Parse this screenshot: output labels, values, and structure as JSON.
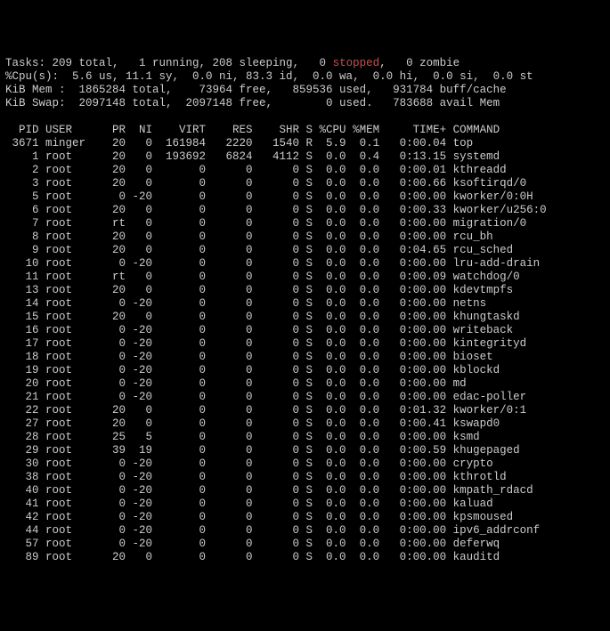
{
  "summary": {
    "tasks_line_pre": "Tasks: 209 total,   1 running, 208 sleeping,   0 ",
    "tasks_stopped_word": "stopped",
    "tasks_line_post": ",   0 zombie",
    "cpu_line": "%Cpu(s):  5.6 us, 11.1 sy,  0.0 ni, 83.3 id,  0.0 wa,  0.0 hi,  0.0 si,  0.0 st",
    "mem_line": "KiB Mem :  1865284 total,    73964 free,   859536 used,   931784 buff/cache",
    "swap_line": "KiB Swap:  2097148 total,  2097148 free,        0 used.   783688 avail Mem"
  },
  "columns": "  PID USER      PR  NI    VIRT    RES    SHR S %CPU %MEM     TIME+ COMMAND          ",
  "processes": [
    {
      "pid": 3671,
      "user": "minger",
      "pr": "20",
      "ni": "0",
      "virt": "161984",
      "res": "2220",
      "shr": "1540",
      "s": "R",
      "cpu": "5.9",
      "mem": "0.1",
      "time": "0:00.04",
      "cmd": "top"
    },
    {
      "pid": 1,
      "user": "root",
      "pr": "20",
      "ni": "0",
      "virt": "193692",
      "res": "6824",
      "shr": "4112",
      "s": "S",
      "cpu": "0.0",
      "mem": "0.4",
      "time": "0:13.15",
      "cmd": "systemd"
    },
    {
      "pid": 2,
      "user": "root",
      "pr": "20",
      "ni": "0",
      "virt": "0",
      "res": "0",
      "shr": "0",
      "s": "S",
      "cpu": "0.0",
      "mem": "0.0",
      "time": "0:00.01",
      "cmd": "kthreadd"
    },
    {
      "pid": 3,
      "user": "root",
      "pr": "20",
      "ni": "0",
      "virt": "0",
      "res": "0",
      "shr": "0",
      "s": "S",
      "cpu": "0.0",
      "mem": "0.0",
      "time": "0:00.66",
      "cmd": "ksoftirqd/0"
    },
    {
      "pid": 5,
      "user": "root",
      "pr": "0",
      "ni": "-20",
      "virt": "0",
      "res": "0",
      "shr": "0",
      "s": "S",
      "cpu": "0.0",
      "mem": "0.0",
      "time": "0:00.00",
      "cmd": "kworker/0:0H"
    },
    {
      "pid": 6,
      "user": "root",
      "pr": "20",
      "ni": "0",
      "virt": "0",
      "res": "0",
      "shr": "0",
      "s": "S",
      "cpu": "0.0",
      "mem": "0.0",
      "time": "0:00.33",
      "cmd": "kworker/u256:0"
    },
    {
      "pid": 7,
      "user": "root",
      "pr": "rt",
      "ni": "0",
      "virt": "0",
      "res": "0",
      "shr": "0",
      "s": "S",
      "cpu": "0.0",
      "mem": "0.0",
      "time": "0:00.00",
      "cmd": "migration/0"
    },
    {
      "pid": 8,
      "user": "root",
      "pr": "20",
      "ni": "0",
      "virt": "0",
      "res": "0",
      "shr": "0",
      "s": "S",
      "cpu": "0.0",
      "mem": "0.0",
      "time": "0:00.00",
      "cmd": "rcu_bh"
    },
    {
      "pid": 9,
      "user": "root",
      "pr": "20",
      "ni": "0",
      "virt": "0",
      "res": "0",
      "shr": "0",
      "s": "S",
      "cpu": "0.0",
      "mem": "0.0",
      "time": "0:04.65",
      "cmd": "rcu_sched"
    },
    {
      "pid": 10,
      "user": "root",
      "pr": "0",
      "ni": "-20",
      "virt": "0",
      "res": "0",
      "shr": "0",
      "s": "S",
      "cpu": "0.0",
      "mem": "0.0",
      "time": "0:00.00",
      "cmd": "lru-add-drain"
    },
    {
      "pid": 11,
      "user": "root",
      "pr": "rt",
      "ni": "0",
      "virt": "0",
      "res": "0",
      "shr": "0",
      "s": "S",
      "cpu": "0.0",
      "mem": "0.0",
      "time": "0:00.09",
      "cmd": "watchdog/0"
    },
    {
      "pid": 13,
      "user": "root",
      "pr": "20",
      "ni": "0",
      "virt": "0",
      "res": "0",
      "shr": "0",
      "s": "S",
      "cpu": "0.0",
      "mem": "0.0",
      "time": "0:00.00",
      "cmd": "kdevtmpfs"
    },
    {
      "pid": 14,
      "user": "root",
      "pr": "0",
      "ni": "-20",
      "virt": "0",
      "res": "0",
      "shr": "0",
      "s": "S",
      "cpu": "0.0",
      "mem": "0.0",
      "time": "0:00.00",
      "cmd": "netns"
    },
    {
      "pid": 15,
      "user": "root",
      "pr": "20",
      "ni": "0",
      "virt": "0",
      "res": "0",
      "shr": "0",
      "s": "S",
      "cpu": "0.0",
      "mem": "0.0",
      "time": "0:00.00",
      "cmd": "khungtaskd"
    },
    {
      "pid": 16,
      "user": "root",
      "pr": "0",
      "ni": "-20",
      "virt": "0",
      "res": "0",
      "shr": "0",
      "s": "S",
      "cpu": "0.0",
      "mem": "0.0",
      "time": "0:00.00",
      "cmd": "writeback"
    },
    {
      "pid": 17,
      "user": "root",
      "pr": "0",
      "ni": "-20",
      "virt": "0",
      "res": "0",
      "shr": "0",
      "s": "S",
      "cpu": "0.0",
      "mem": "0.0",
      "time": "0:00.00",
      "cmd": "kintegrityd"
    },
    {
      "pid": 18,
      "user": "root",
      "pr": "0",
      "ni": "-20",
      "virt": "0",
      "res": "0",
      "shr": "0",
      "s": "S",
      "cpu": "0.0",
      "mem": "0.0",
      "time": "0:00.00",
      "cmd": "bioset"
    },
    {
      "pid": 19,
      "user": "root",
      "pr": "0",
      "ni": "-20",
      "virt": "0",
      "res": "0",
      "shr": "0",
      "s": "S",
      "cpu": "0.0",
      "mem": "0.0",
      "time": "0:00.00",
      "cmd": "kblockd"
    },
    {
      "pid": 20,
      "user": "root",
      "pr": "0",
      "ni": "-20",
      "virt": "0",
      "res": "0",
      "shr": "0",
      "s": "S",
      "cpu": "0.0",
      "mem": "0.0",
      "time": "0:00.00",
      "cmd": "md"
    },
    {
      "pid": 21,
      "user": "root",
      "pr": "0",
      "ni": "-20",
      "virt": "0",
      "res": "0",
      "shr": "0",
      "s": "S",
      "cpu": "0.0",
      "mem": "0.0",
      "time": "0:00.00",
      "cmd": "edac-poller"
    },
    {
      "pid": 22,
      "user": "root",
      "pr": "20",
      "ni": "0",
      "virt": "0",
      "res": "0",
      "shr": "0",
      "s": "S",
      "cpu": "0.0",
      "mem": "0.0",
      "time": "0:01.32",
      "cmd": "kworker/0:1"
    },
    {
      "pid": 27,
      "user": "root",
      "pr": "20",
      "ni": "0",
      "virt": "0",
      "res": "0",
      "shr": "0",
      "s": "S",
      "cpu": "0.0",
      "mem": "0.0",
      "time": "0:00.41",
      "cmd": "kswapd0"
    },
    {
      "pid": 28,
      "user": "root",
      "pr": "25",
      "ni": "5",
      "virt": "0",
      "res": "0",
      "shr": "0",
      "s": "S",
      "cpu": "0.0",
      "mem": "0.0",
      "time": "0:00.00",
      "cmd": "ksmd"
    },
    {
      "pid": 29,
      "user": "root",
      "pr": "39",
      "ni": "19",
      "virt": "0",
      "res": "0",
      "shr": "0",
      "s": "S",
      "cpu": "0.0",
      "mem": "0.0",
      "time": "0:00.59",
      "cmd": "khugepaged"
    },
    {
      "pid": 30,
      "user": "root",
      "pr": "0",
      "ni": "-20",
      "virt": "0",
      "res": "0",
      "shr": "0",
      "s": "S",
      "cpu": "0.0",
      "mem": "0.0",
      "time": "0:00.00",
      "cmd": "crypto"
    },
    {
      "pid": 38,
      "user": "root",
      "pr": "0",
      "ni": "-20",
      "virt": "0",
      "res": "0",
      "shr": "0",
      "s": "S",
      "cpu": "0.0",
      "mem": "0.0",
      "time": "0:00.00",
      "cmd": "kthrotld"
    },
    {
      "pid": 40,
      "user": "root",
      "pr": "0",
      "ni": "-20",
      "virt": "0",
      "res": "0",
      "shr": "0",
      "s": "S",
      "cpu": "0.0",
      "mem": "0.0",
      "time": "0:00.00",
      "cmd": "kmpath_rdacd"
    },
    {
      "pid": 41,
      "user": "root",
      "pr": "0",
      "ni": "-20",
      "virt": "0",
      "res": "0",
      "shr": "0",
      "s": "S",
      "cpu": "0.0",
      "mem": "0.0",
      "time": "0:00.00",
      "cmd": "kaluad"
    },
    {
      "pid": 42,
      "user": "root",
      "pr": "0",
      "ni": "-20",
      "virt": "0",
      "res": "0",
      "shr": "0",
      "s": "S",
      "cpu": "0.0",
      "mem": "0.0",
      "time": "0:00.00",
      "cmd": "kpsmoused"
    },
    {
      "pid": 44,
      "user": "root",
      "pr": "0",
      "ni": "-20",
      "virt": "0",
      "res": "0",
      "shr": "0",
      "s": "S",
      "cpu": "0.0",
      "mem": "0.0",
      "time": "0:00.00",
      "cmd": "ipv6_addrconf"
    },
    {
      "pid": 57,
      "user": "root",
      "pr": "0",
      "ni": "-20",
      "virt": "0",
      "res": "0",
      "shr": "0",
      "s": "S",
      "cpu": "0.0",
      "mem": "0.0",
      "time": "0:00.00",
      "cmd": "deferwq"
    },
    {
      "pid": 89,
      "user": "root",
      "pr": "20",
      "ni": "0",
      "virt": "0",
      "res": "0",
      "shr": "0",
      "s": "S",
      "cpu": "0.0",
      "mem": "0.0",
      "time": "0:00.00",
      "cmd": "kauditd"
    }
  ]
}
